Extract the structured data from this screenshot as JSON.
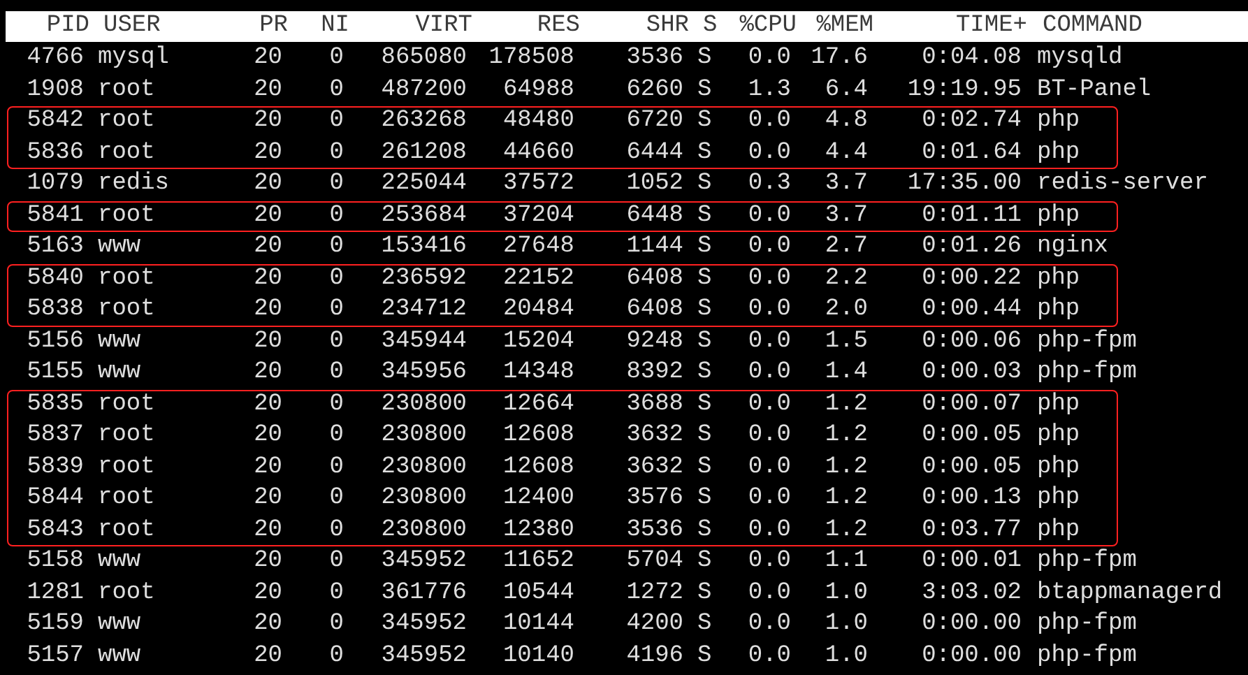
{
  "table": {
    "columns": [
      "PID",
      "USER",
      "PR",
      "NI",
      "VIRT",
      "RES",
      "SHR",
      "S",
      "%CPU",
      "%MEM",
      "TIME+",
      "COMMAND"
    ],
    "groups": [
      {
        "highlighted": false,
        "rows": [
          [
            "4766",
            "mysql",
            "20",
            "0",
            "865080",
            "178508",
            "3536",
            "S",
            "0.0",
            "17.6",
            "0:04.08",
            "mysqld"
          ],
          [
            "1908",
            "root",
            "20",
            "0",
            "487200",
            "64988",
            "6260",
            "S",
            "1.3",
            "6.4",
            "19:19.95",
            "BT-Panel"
          ]
        ]
      },
      {
        "highlighted": true,
        "rows": [
          [
            "5842",
            "root",
            "20",
            "0",
            "263268",
            "48480",
            "6720",
            "S",
            "0.0",
            "4.8",
            "0:02.74",
            "php"
          ],
          [
            "5836",
            "root",
            "20",
            "0",
            "261208",
            "44660",
            "6444",
            "S",
            "0.0",
            "4.4",
            "0:01.64",
            "php"
          ]
        ]
      },
      {
        "highlighted": false,
        "rows": [
          [
            "1079",
            "redis",
            "20",
            "0",
            "225044",
            "37572",
            "1052",
            "S",
            "0.3",
            "3.7",
            "17:35.00",
            "redis-server"
          ]
        ]
      },
      {
        "highlighted": true,
        "rows": [
          [
            "5841",
            "root",
            "20",
            "0",
            "253684",
            "37204",
            "6448",
            "S",
            "0.0",
            "3.7",
            "0:01.11",
            "php"
          ]
        ]
      },
      {
        "highlighted": false,
        "rows": [
          [
            "5163",
            "www",
            "20",
            "0",
            "153416",
            "27648",
            "1144",
            "S",
            "0.0",
            "2.7",
            "0:01.26",
            "nginx"
          ]
        ]
      },
      {
        "highlighted": true,
        "rows": [
          [
            "5840",
            "root",
            "20",
            "0",
            "236592",
            "22152",
            "6408",
            "S",
            "0.0",
            "2.2",
            "0:00.22",
            "php"
          ],
          [
            "5838",
            "root",
            "20",
            "0",
            "234712",
            "20484",
            "6408",
            "S",
            "0.0",
            "2.0",
            "0:00.44",
            "php"
          ]
        ]
      },
      {
        "highlighted": false,
        "rows": [
          [
            "5156",
            "www",
            "20",
            "0",
            "345944",
            "15204",
            "9248",
            "S",
            "0.0",
            "1.5",
            "0:00.06",
            "php-fpm"
          ],
          [
            "5155",
            "www",
            "20",
            "0",
            "345956",
            "14348",
            "8392",
            "S",
            "0.0",
            "1.4",
            "0:00.03",
            "php-fpm"
          ]
        ]
      },
      {
        "highlighted": true,
        "rows": [
          [
            "5835",
            "root",
            "20",
            "0",
            "230800",
            "12664",
            "3688",
            "S",
            "0.0",
            "1.2",
            "0:00.07",
            "php"
          ],
          [
            "5837",
            "root",
            "20",
            "0",
            "230800",
            "12608",
            "3632",
            "S",
            "0.0",
            "1.2",
            "0:00.05",
            "php"
          ],
          [
            "5839",
            "root",
            "20",
            "0",
            "230800",
            "12608",
            "3632",
            "S",
            "0.0",
            "1.2",
            "0:00.05",
            "php"
          ],
          [
            "5844",
            "root",
            "20",
            "0",
            "230800",
            "12400",
            "3576",
            "S",
            "0.0",
            "1.2",
            "0:00.13",
            "php"
          ],
          [
            "5843",
            "root",
            "20",
            "0",
            "230800",
            "12380",
            "3536",
            "S",
            "0.0",
            "1.2",
            "0:03.77",
            "php"
          ]
        ]
      },
      {
        "highlighted": false,
        "rows": [
          [
            "5158",
            "www",
            "20",
            "0",
            "345952",
            "11652",
            "5704",
            "S",
            "0.0",
            "1.1",
            "0:00.01",
            "php-fpm"
          ],
          [
            "1281",
            "root",
            "20",
            "0",
            "361776",
            "10544",
            "1272",
            "S",
            "0.0",
            "1.0",
            "3:03.02",
            "btappmanagerd"
          ],
          [
            "5159",
            "www",
            "20",
            "0",
            "345952",
            "10144",
            "4200",
            "S",
            "0.0",
            "1.0",
            "0:00.00",
            "php-fpm"
          ],
          [
            "5157",
            "www",
            "20",
            "0",
            "345952",
            "10140",
            "4196",
            "S",
            "0.0",
            "1.0",
            "0:00.00",
            "php-fpm"
          ]
        ]
      }
    ]
  }
}
